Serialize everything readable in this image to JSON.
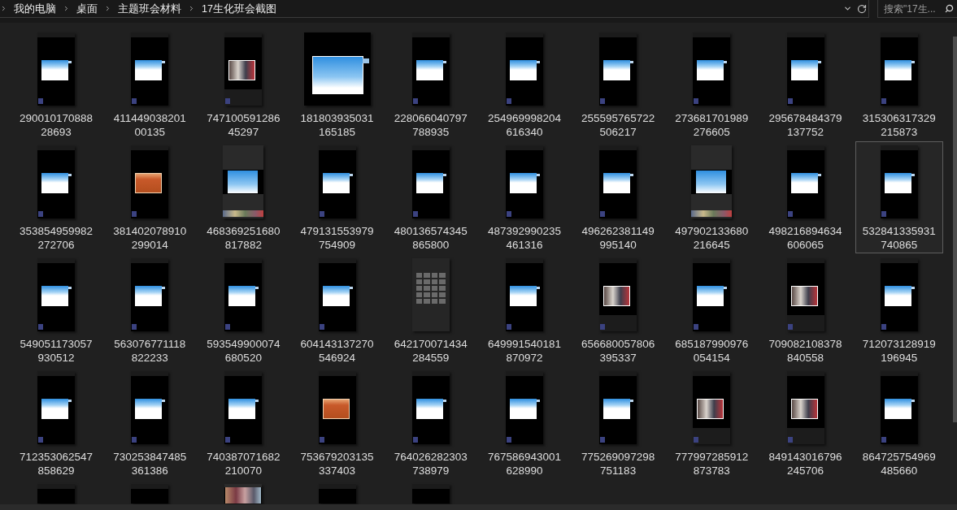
{
  "address_bar": {
    "breadcrumbs": [
      "我的电脑",
      "桌面",
      "主题班会材料",
      "17生化班会截图"
    ]
  },
  "search": {
    "placeholder": "搜索\"17生..."
  },
  "items": [
    {
      "label": "29001017088828693",
      "kind": "slide",
      "selected": false
    },
    {
      "label": "41144903820100135",
      "kind": "slide",
      "selected": false
    },
    {
      "label": "74710059128645297",
      "kind": "photo",
      "selected": false
    },
    {
      "label": "181803935031165185",
      "kind": "landscape",
      "selected": false
    },
    {
      "label": "228066040797788935",
      "kind": "slide",
      "selected": false
    },
    {
      "label": "254969998204616340",
      "kind": "slide",
      "selected": false
    },
    {
      "label": "255595765722506217",
      "kind": "slide",
      "selected": false
    },
    {
      "label": "273681701989276605",
      "kind": "slide",
      "selected": false
    },
    {
      "label": "295678484379137752",
      "kind": "slide",
      "selected": false
    },
    {
      "label": "315306317329215873",
      "kind": "slide",
      "selected": false
    },
    {
      "label": "353854959982272706",
      "kind": "slide",
      "selected": false
    },
    {
      "label": "381402078910299014",
      "kind": "orange",
      "selected": false
    },
    {
      "label": "468369251680817882",
      "kind": "framed",
      "selected": false
    },
    {
      "label": "479131553979754909",
      "kind": "slide",
      "selected": false
    },
    {
      "label": "480136574345865800",
      "kind": "slide",
      "selected": false
    },
    {
      "label": "487392990235461316",
      "kind": "slide",
      "selected": false
    },
    {
      "label": "496262381149995140",
      "kind": "slide",
      "selected": false
    },
    {
      "label": "497902133680216645",
      "kind": "framed",
      "selected": false
    },
    {
      "label": "498216894634606065",
      "kind": "slide",
      "selected": false
    },
    {
      "label": "532841335931740865",
      "kind": "slide",
      "selected": true
    },
    {
      "label": "549051173057930512",
      "kind": "slide",
      "selected": false
    },
    {
      "label": "563076771118822233",
      "kind": "slide",
      "selected": false
    },
    {
      "label": "593549900074680520",
      "kind": "slide",
      "selected": false
    },
    {
      "label": "604143137270546924",
      "kind": "slide",
      "selected": false
    },
    {
      "label": "642170071434284559",
      "kind": "gallery",
      "selected": false
    },
    {
      "label": "649991540181870972",
      "kind": "slide",
      "selected": false
    },
    {
      "label": "656680057806395337",
      "kind": "photo",
      "selected": false
    },
    {
      "label": "685187990976054154",
      "kind": "slide",
      "selected": false
    },
    {
      "label": "709082108378840558",
      "kind": "photo",
      "selected": false
    },
    {
      "label": "712073128919196945",
      "kind": "slide",
      "selected": false
    },
    {
      "label": "712353062547858629",
      "kind": "slide",
      "selected": false
    },
    {
      "label": "730253847485361386",
      "kind": "slide",
      "selected": false
    },
    {
      "label": "740387071682210070",
      "kind": "slide",
      "selected": false
    },
    {
      "label": "753679203135337403",
      "kind": "orange",
      "selected": false
    },
    {
      "label": "764026282303738979",
      "kind": "slide",
      "selected": false
    },
    {
      "label": "767586943001628990",
      "kind": "slide",
      "selected": false
    },
    {
      "label": "775269097298751183",
      "kind": "slide",
      "selected": false
    },
    {
      "label": "777997285912873783",
      "kind": "photo",
      "selected": false
    },
    {
      "label": "849143016796245706",
      "kind": "photo",
      "selected": false
    },
    {
      "label": "864725754969485660",
      "kind": "slide",
      "selected": false
    },
    {
      "kind": "slide",
      "selected": false
    },
    {
      "kind": "slide",
      "selected": false
    },
    {
      "kind": "snapshot",
      "selected": false
    },
    {
      "kind": "slide",
      "selected": false
    },
    {
      "kind": "slide",
      "selected": false
    }
  ]
}
